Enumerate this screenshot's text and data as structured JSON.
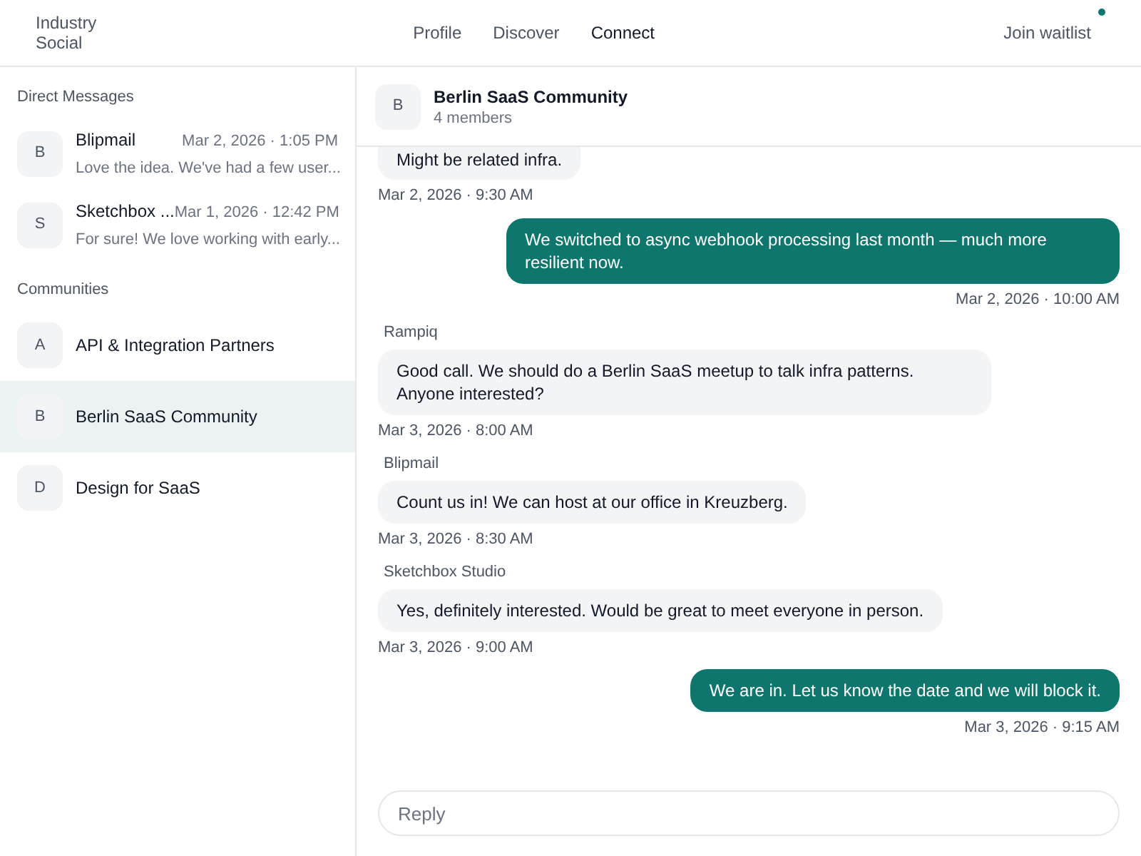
{
  "brand": "Industry Social",
  "nav": [
    {
      "label": "Profile",
      "selected": false
    },
    {
      "label": "Discover",
      "selected": false
    },
    {
      "label": "Connect",
      "selected": true
    }
  ],
  "join": {
    "label": "Join waitlist",
    "dot": true
  },
  "sidebar": {
    "dm_heading": "Direct Messages",
    "direct_messages": [
      {
        "avatar": "B",
        "name": "Blipmail",
        "time": "Mar 2, 2026 · 1:05 PM",
        "preview": "Love the idea. We've had a few user..."
      },
      {
        "avatar": "S",
        "name": "Sketchbox ...",
        "time": "Mar 1, 2026 · 12:42 PM",
        "preview": "For sure! We love working with early..."
      }
    ],
    "communities_heading": "Communities",
    "communities": [
      {
        "avatar": "A",
        "name": "API & Integration Partners",
        "selected": false
      },
      {
        "avatar": "B",
        "name": "Berlin SaaS Community",
        "selected": true
      },
      {
        "avatar": "D",
        "name": "Design for SaaS",
        "selected": false
      }
    ]
  },
  "chat": {
    "avatar": "B",
    "title": "Berlin SaaS Community",
    "members": "4 members",
    "messages": [
      {
        "kind": "received",
        "partial": true,
        "text": "Might be related infra.",
        "time": "Mar 2, 2026 · 9:30 AM"
      },
      {
        "kind": "sent",
        "text": "We switched to async webhook processing last month — much more resilient now.",
        "time": "Mar 2, 2026 · 10:00 AM"
      },
      {
        "kind": "received",
        "sender": "Rampiq",
        "text": "Good call. We should do a Berlin SaaS meetup to talk infra patterns. Anyone interested?",
        "time": "Mar 3, 2026 · 8:00 AM"
      },
      {
        "kind": "received",
        "sender": "Blipmail",
        "text": "Count us in! We can host at our office in Kreuzberg.",
        "time": "Mar 3, 2026 · 8:30 AM"
      },
      {
        "kind": "received",
        "sender": "Sketchbox Studio",
        "text": "Yes, definitely interested. Would be great to meet everyone in person.",
        "time": "Mar 3, 2026 · 9:00 AM"
      },
      {
        "kind": "sent",
        "text": "We are in. Let us know the date and we will block it.",
        "time": "Mar 3, 2026 · 9:15 AM"
      }
    ],
    "reply": {
      "placeholder": "Reply"
    }
  }
}
